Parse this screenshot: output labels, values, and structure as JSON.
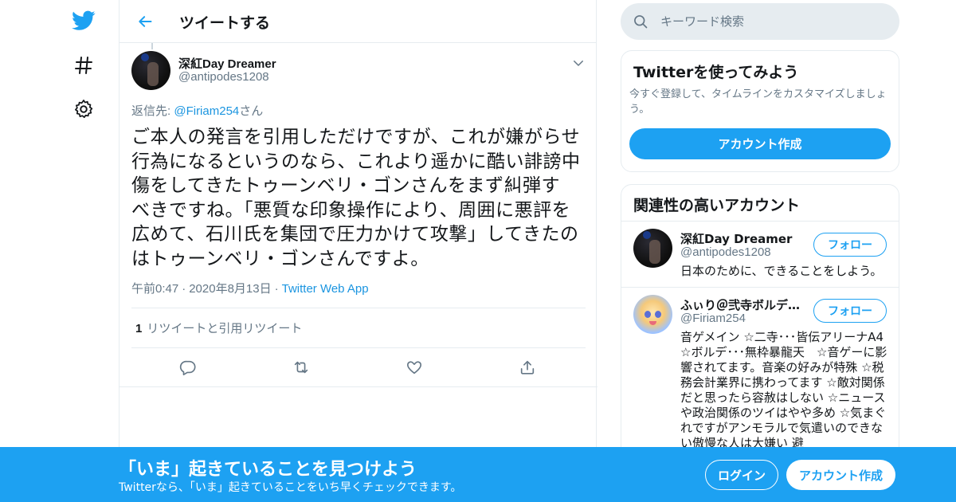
{
  "colors": {
    "brand": "#1da1f2",
    "link": "#1b95e0",
    "text": "#14171a",
    "muted": "#657786",
    "border": "#e6ecf0"
  },
  "nav": {
    "icons": [
      "twitter-bird-icon",
      "hashtag-icon",
      "gear-icon"
    ]
  },
  "header": {
    "back_icon": "back-arrow-icon",
    "title": "ツイートする"
  },
  "tweet": {
    "display_name": "深紅Day Dreamer",
    "handle": "@antipodes1208",
    "reply_prefix": "返信先: ",
    "reply_mention": "@Firiam254",
    "reply_suffix": "さん",
    "lines": [
      "ご本人の発言を引用しただけですが、これが嫌がらせ",
      "行為になるというのなら、これより遥かに酷い誹謗中",
      "傷をしてきたトゥーンベリ・ゴンさんをまず糾弾す",
      "べきですね。「悪質な印象操作により、周囲に悪評を",
      "広めて、石川氏を集団で圧力かけて攻撃」してきたの",
      "はトゥーンベリ・ゴンさんですよ。"
    ],
    "time": "午前0:47",
    "date": "2020年8月13日",
    "source": "Twitter Web App",
    "dot": "·",
    "retweet_count": "1",
    "retweet_label": "リツイートと引用リツイート",
    "action_icons": [
      "reply-icon",
      "retweet-icon",
      "like-icon",
      "share-icon"
    ]
  },
  "search": {
    "placeholder": "キーワード検索"
  },
  "signup_card": {
    "title": "Twitterを使ってみよう",
    "desc": "今すぐ登録して、タイムラインをカスタマイズしましょう。",
    "button": "アカウント作成"
  },
  "related": {
    "title": "関連性の高いアカウント",
    "accounts": [
      {
        "name": "深紅Day Dreamer",
        "handle": "@antipodes1208",
        "follow": "フォロー",
        "bio": "日本のために、できることをしよう。"
      },
      {
        "name": "ふぃり＠弐寺ボルデ…",
        "handle": "@Firiam254",
        "follow": "フォロー",
        "bio": "音ゲメイン ☆二寺･･･皆伝アリーナA4　☆ボルデ･･･無枠暴龍天　☆音ゲーに影響されてます。音楽の好みが特殊 ☆税務会計業界に携わってます ☆敵対関係だと思ったら容赦はしない ☆ニュースや政治関係のツイはやや多め ☆気まぐれですがアンモラルで気遣いのできない傲慢な人は大嫌い 避"
      }
    ]
  },
  "banner": {
    "title": "「いま」起きていることを見つけよう",
    "subtitle": "Twitterなら、「いま」起きていることをいち早くチェックできます。",
    "login": "ログイン",
    "signup": "アカウント作成"
  }
}
